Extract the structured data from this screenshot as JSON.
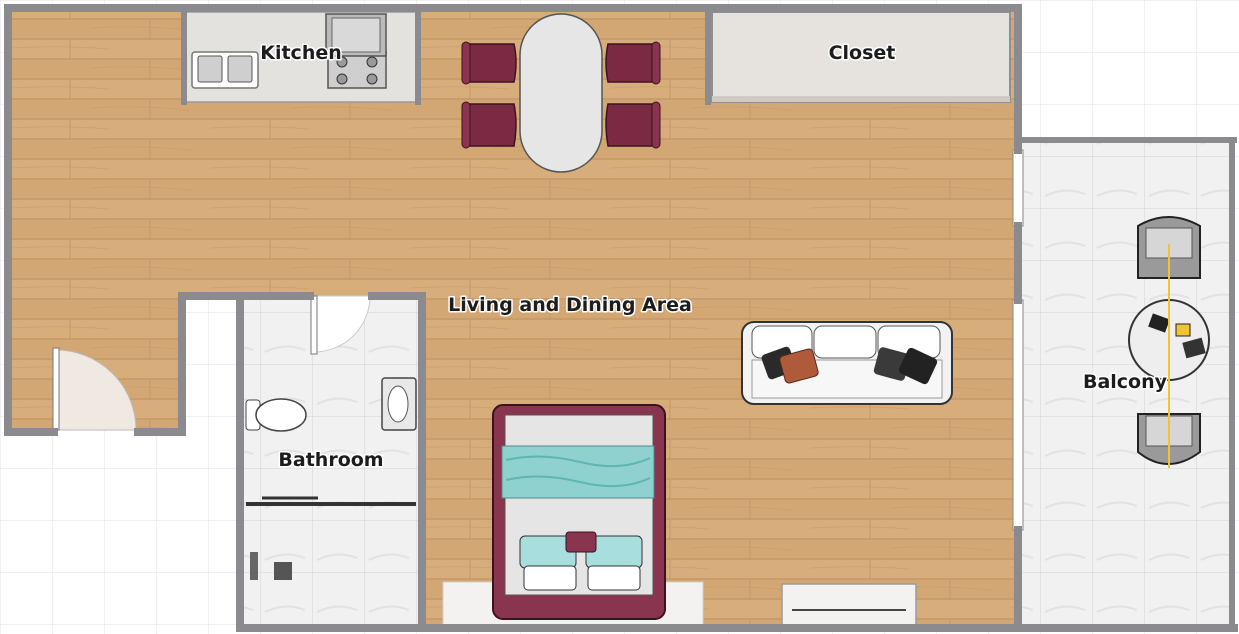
{
  "rooms": {
    "kitchen": "Kitchen",
    "closet": "Closet",
    "living": "Living and Dining Area",
    "bathroom": "Bathroom",
    "balcony": "Balcony"
  },
  "colors": {
    "wood_floor": "#d3a774",
    "tile_floor": "#f1f1f1",
    "wall": "#8a8a8f",
    "chair": "#7c2a43",
    "bed_frame": "#8a3550",
    "bed_blanket": "#8fd1cf",
    "grid": "#e3e3ea"
  }
}
